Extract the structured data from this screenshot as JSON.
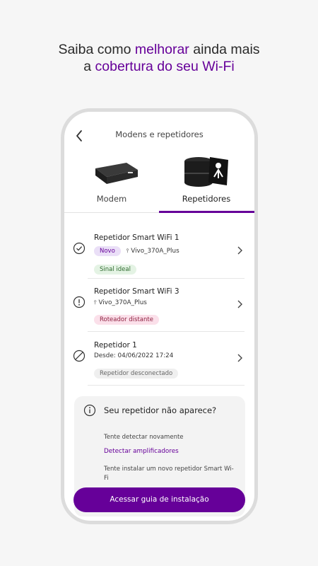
{
  "headline": {
    "part1": "Saiba como ",
    "highlight1": "melhorar",
    "part2": " ainda mais",
    "part3": "a ",
    "highlight2": "cobertura do seu Wi-Fi"
  },
  "appbar": {
    "title": "Modens e repetidores"
  },
  "tabs": [
    {
      "label": "Modem",
      "selected": false
    },
    {
      "label": "Repetidores",
      "selected": true
    }
  ],
  "devices": [
    {
      "name": "Repetidor Smart WiFi  1",
      "tag": "Novo",
      "network": "Vivo_370A_Plus",
      "status": "Sinal ideal",
      "icon": "check-circle-icon"
    },
    {
      "name": "Repetidor Smart WiFi  3",
      "network": "Vivo_370A_Plus",
      "status": "Roteador distante",
      "icon": "info-circle-icon"
    },
    {
      "name": "Repetidor 1",
      "since": "Desde: 04/06/2022 17:24",
      "status": "Repetidor desconectado",
      "icon": "blocked-circle-icon"
    }
  ],
  "help": {
    "title": "Seu repetidor não aparece?",
    "text1": "Tente detectar novamente",
    "link": "Detectar amplificadores",
    "text2": "Tente instalar um novo repetidor Smart Wi-Fi"
  },
  "cta": {
    "label": "Acessar guia de instalação"
  },
  "colors": {
    "brand": "#660099",
    "background": "#f6f6f6"
  }
}
